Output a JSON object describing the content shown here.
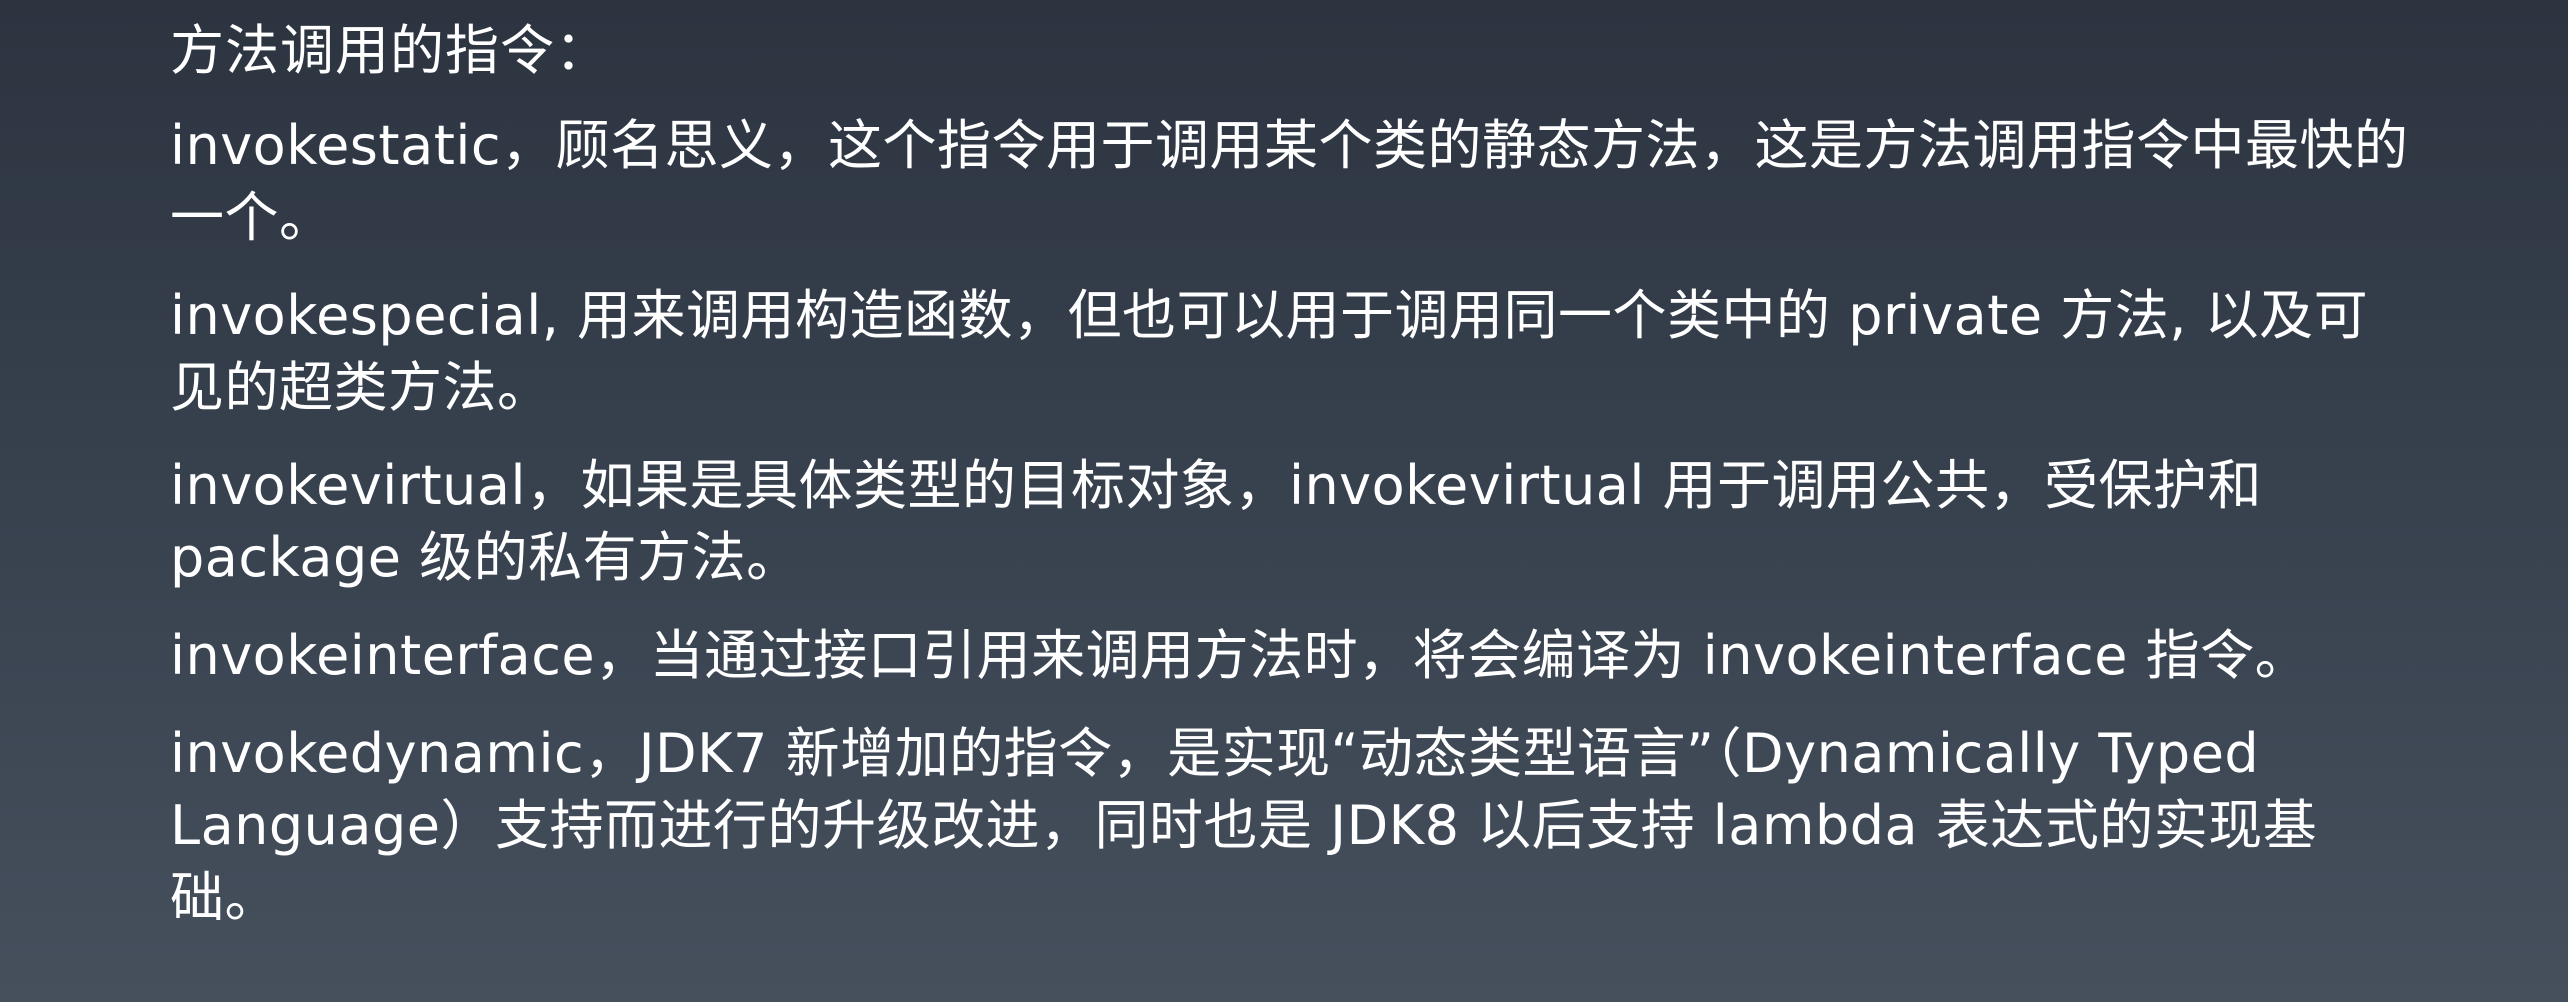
{
  "slide": {
    "heading": "方法调用的指令：",
    "paragraphs": [
      "invokestatic，顾名思义，这个指令用于调用某个类的静态方法，这是方法调用指令中最快的一个。",
      "invokespecial, 用来调用构造函数，但也可以用于调用同一个类中的 private 方法, 以及可见的超类方法。",
      "invokevirtual，如果是具体类型的目标对象，invokevirtual 用于调用公共，受保护和package 级的私有方法。",
      "invokeinterface，当通过接口引用来调用方法时，将会编译为 invokeinterface 指令。",
      "invokedynamic，JDK7 新增加的指令，是实现“动态类型语言”（Dynamically Typed Language）支持而进行的升级改进，同时也是 JDK8 以后支持 lambda 表达式的实现基础。"
    ]
  }
}
